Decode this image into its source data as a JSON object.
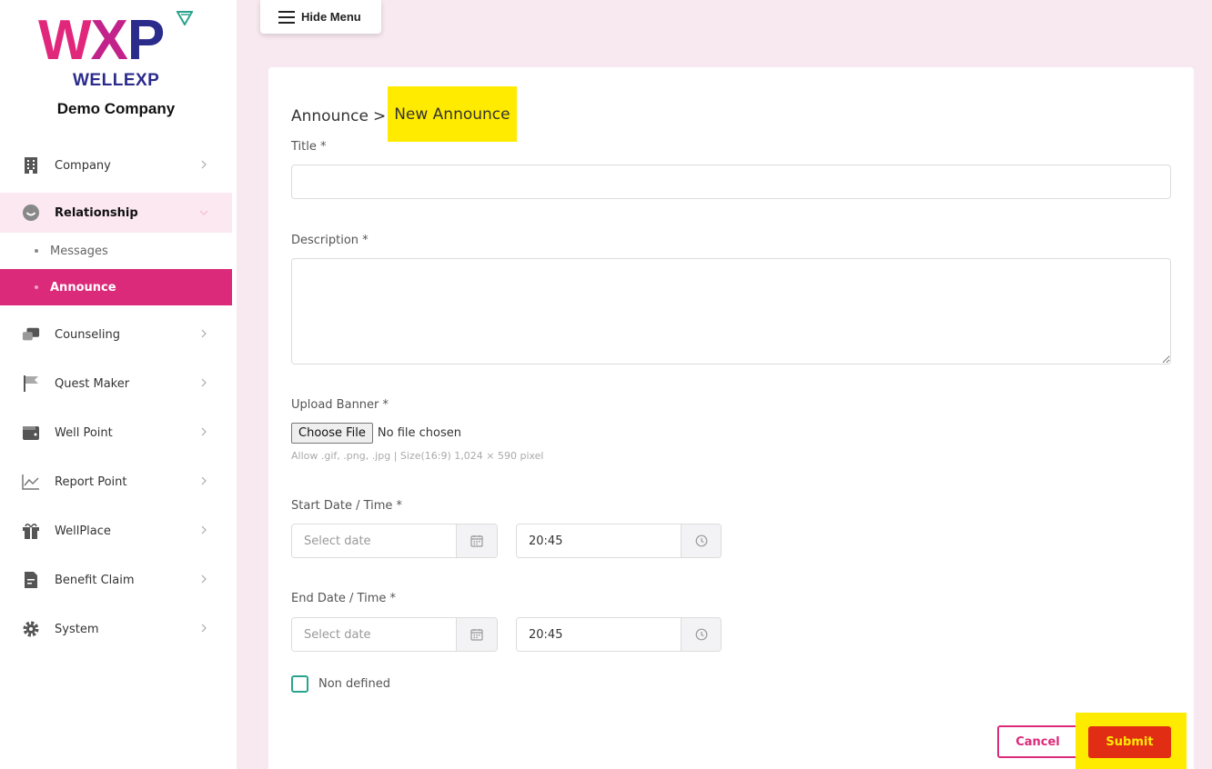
{
  "app": {
    "logo_mark": "WXP",
    "logo_text": "WELLEXP",
    "company": "Demo Company"
  },
  "sidebar": {
    "items": [
      {
        "label": "Company",
        "icon": "building-icon"
      },
      {
        "label": "Relationship",
        "icon": "smile-icon",
        "expanded": true,
        "children": [
          {
            "label": "Messages",
            "active": false
          },
          {
            "label": "Announce",
            "active": true
          }
        ]
      },
      {
        "label": "Counseling",
        "icon": "chat-icon"
      },
      {
        "label": "Quest Maker",
        "icon": "flag-icon"
      },
      {
        "label": "Well Point",
        "icon": "wallet-icon"
      },
      {
        "label": "Report Point",
        "icon": "chart-icon"
      },
      {
        "label": "WellPlace",
        "icon": "gift-icon"
      },
      {
        "label": "Benefit Claim",
        "icon": "document-icon"
      },
      {
        "label": "System",
        "icon": "gear-icon"
      }
    ]
  },
  "toolbar": {
    "hide_menu_label": "Hide Menu"
  },
  "breadcrumb": {
    "parent": "Announce",
    "separator": ">",
    "current": "New Announce"
  },
  "form": {
    "title_label": "Title *",
    "title_value": "",
    "description_label": "Description *",
    "description_value": "",
    "banner_label": "Upload Banner *",
    "banner_button": "Choose File",
    "banner_status": "No file chosen",
    "banner_hint": "Allow .gif, .png, .jpg | Size(16:9) 1,024 × 590 pixel",
    "start_label": "Start Date / Time *",
    "start_date_placeholder": "Select date",
    "start_time_value": "20:45",
    "end_label": "End Date / Time *",
    "end_date_placeholder": "Select date",
    "end_time_value": "20:45",
    "non_defined_label": "Non defined",
    "non_defined_checked": false,
    "cancel_label": "Cancel",
    "submit_label": "Submit"
  },
  "colors": {
    "brand_pink": "#dc2a7a",
    "brand_navy": "#2b2b8c",
    "background": "#f8e8f0",
    "submit_red": "#e02d14",
    "highlight": "#ffeb00",
    "checkbox_green": "#2aa38c"
  }
}
